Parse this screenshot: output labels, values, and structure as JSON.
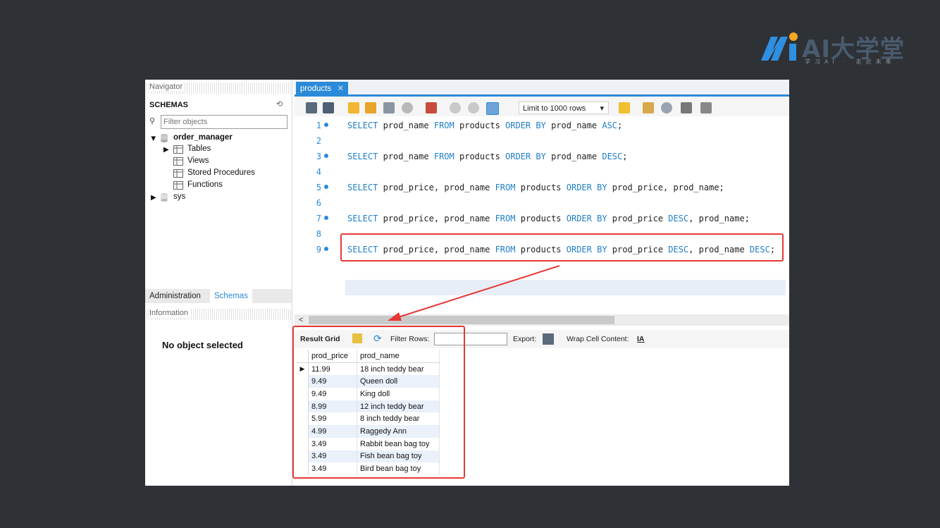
{
  "logo": {
    "brand": "AI大学堂",
    "tagline": "学习AI · 走近未来"
  },
  "navigator": {
    "header": "Navigator",
    "schemas_title": "SCHEMAS",
    "filter_placeholder": "Filter objects",
    "tree": {
      "db": "order_manager",
      "children": [
        "Tables",
        "Views",
        "Stored Procedures",
        "Functions"
      ],
      "other": "sys"
    },
    "tabs": {
      "admin": "Administration",
      "schemas": "Schemas"
    },
    "info_header": "Information",
    "no_object": "No object selected"
  },
  "editor": {
    "tab": "products",
    "limit": "Limit to 1000 rows",
    "lines": [
      {
        "n": "1",
        "dot": true,
        "code": "SELECT prod_name FROM products ORDER BY prod_name ASC;"
      },
      {
        "n": "2",
        "dot": false,
        "code": ""
      },
      {
        "n": "3",
        "dot": true,
        "code": "SELECT prod_name FROM products ORDER BY prod_name DESC;"
      },
      {
        "n": "4",
        "dot": false,
        "code": ""
      },
      {
        "n": "5",
        "dot": true,
        "code": "SELECT prod_price, prod_name FROM products ORDER BY prod_price, prod_name;"
      },
      {
        "n": "6",
        "dot": false,
        "code": ""
      },
      {
        "n": "7",
        "dot": true,
        "code": "SELECT prod_price, prod_name FROM products ORDER BY prod_price DESC, prod_name;"
      },
      {
        "n": "8",
        "dot": false,
        "code": ""
      },
      {
        "n": "9",
        "dot": true,
        "code": "SELECT prod_price, prod_name FROM products ORDER BY prod_price DESC, prod_name DESC;"
      }
    ]
  },
  "results": {
    "toolbar": {
      "grid": "Result Grid",
      "filter": "Filter Rows:",
      "export": "Export:",
      "wrap": "Wrap Cell Content:"
    },
    "columns": [
      "prod_price",
      "prod_name"
    ],
    "rows": [
      [
        "11.99",
        "18 inch teddy bear"
      ],
      [
        "9.49",
        "Queen doll"
      ],
      [
        "9.49",
        "King doll"
      ],
      [
        "8.99",
        "12 inch teddy bear"
      ],
      [
        "5.99",
        "8 inch teddy bear"
      ],
      [
        "4.99",
        "Raggedy Ann"
      ],
      [
        "3.49",
        "Rabbit bean bag toy"
      ],
      [
        "3.49",
        "Fish bean bag toy"
      ],
      [
        "3.49",
        "Bird bean bag toy"
      ]
    ]
  },
  "colors": {
    "accent": "#2b8ad8",
    "annotation": "#e53935",
    "background": "#2e3136"
  }
}
